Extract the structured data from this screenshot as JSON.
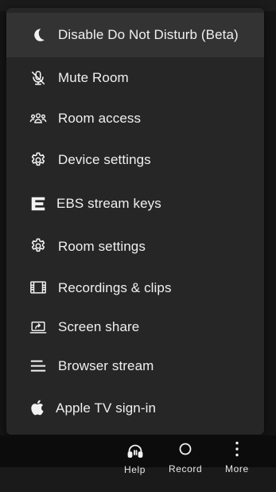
{
  "menu": {
    "items": [
      {
        "label": "Disable Do Not Disturb (Beta)",
        "icon": "moon-icon"
      },
      {
        "label": "Mute Room",
        "icon": "muted-microphone-icon"
      },
      {
        "label": "Room access",
        "icon": "people-group-icon"
      },
      {
        "label": "Device settings",
        "icon": "gear-icon"
      },
      {
        "label": "EBS stream keys",
        "icon": "ebs-logo-icon"
      },
      {
        "label": "Room settings",
        "icon": "gear-icon"
      },
      {
        "label": "Recordings & clips",
        "icon": "film-strip-icon"
      },
      {
        "label": "Screen share",
        "icon": "screen-share-icon"
      },
      {
        "label": "Browser stream",
        "icon": "lines-icon"
      },
      {
        "label": "Apple TV sign-in",
        "icon": "apple-logo-icon"
      }
    ]
  },
  "toolbar": {
    "help_label": "Help",
    "record_label": "Record",
    "more_label": "More"
  },
  "colors": {
    "menu_background": "#262626",
    "menu_highlight": "#333333",
    "text": "#f0f0f0",
    "page_background": "#141414"
  }
}
